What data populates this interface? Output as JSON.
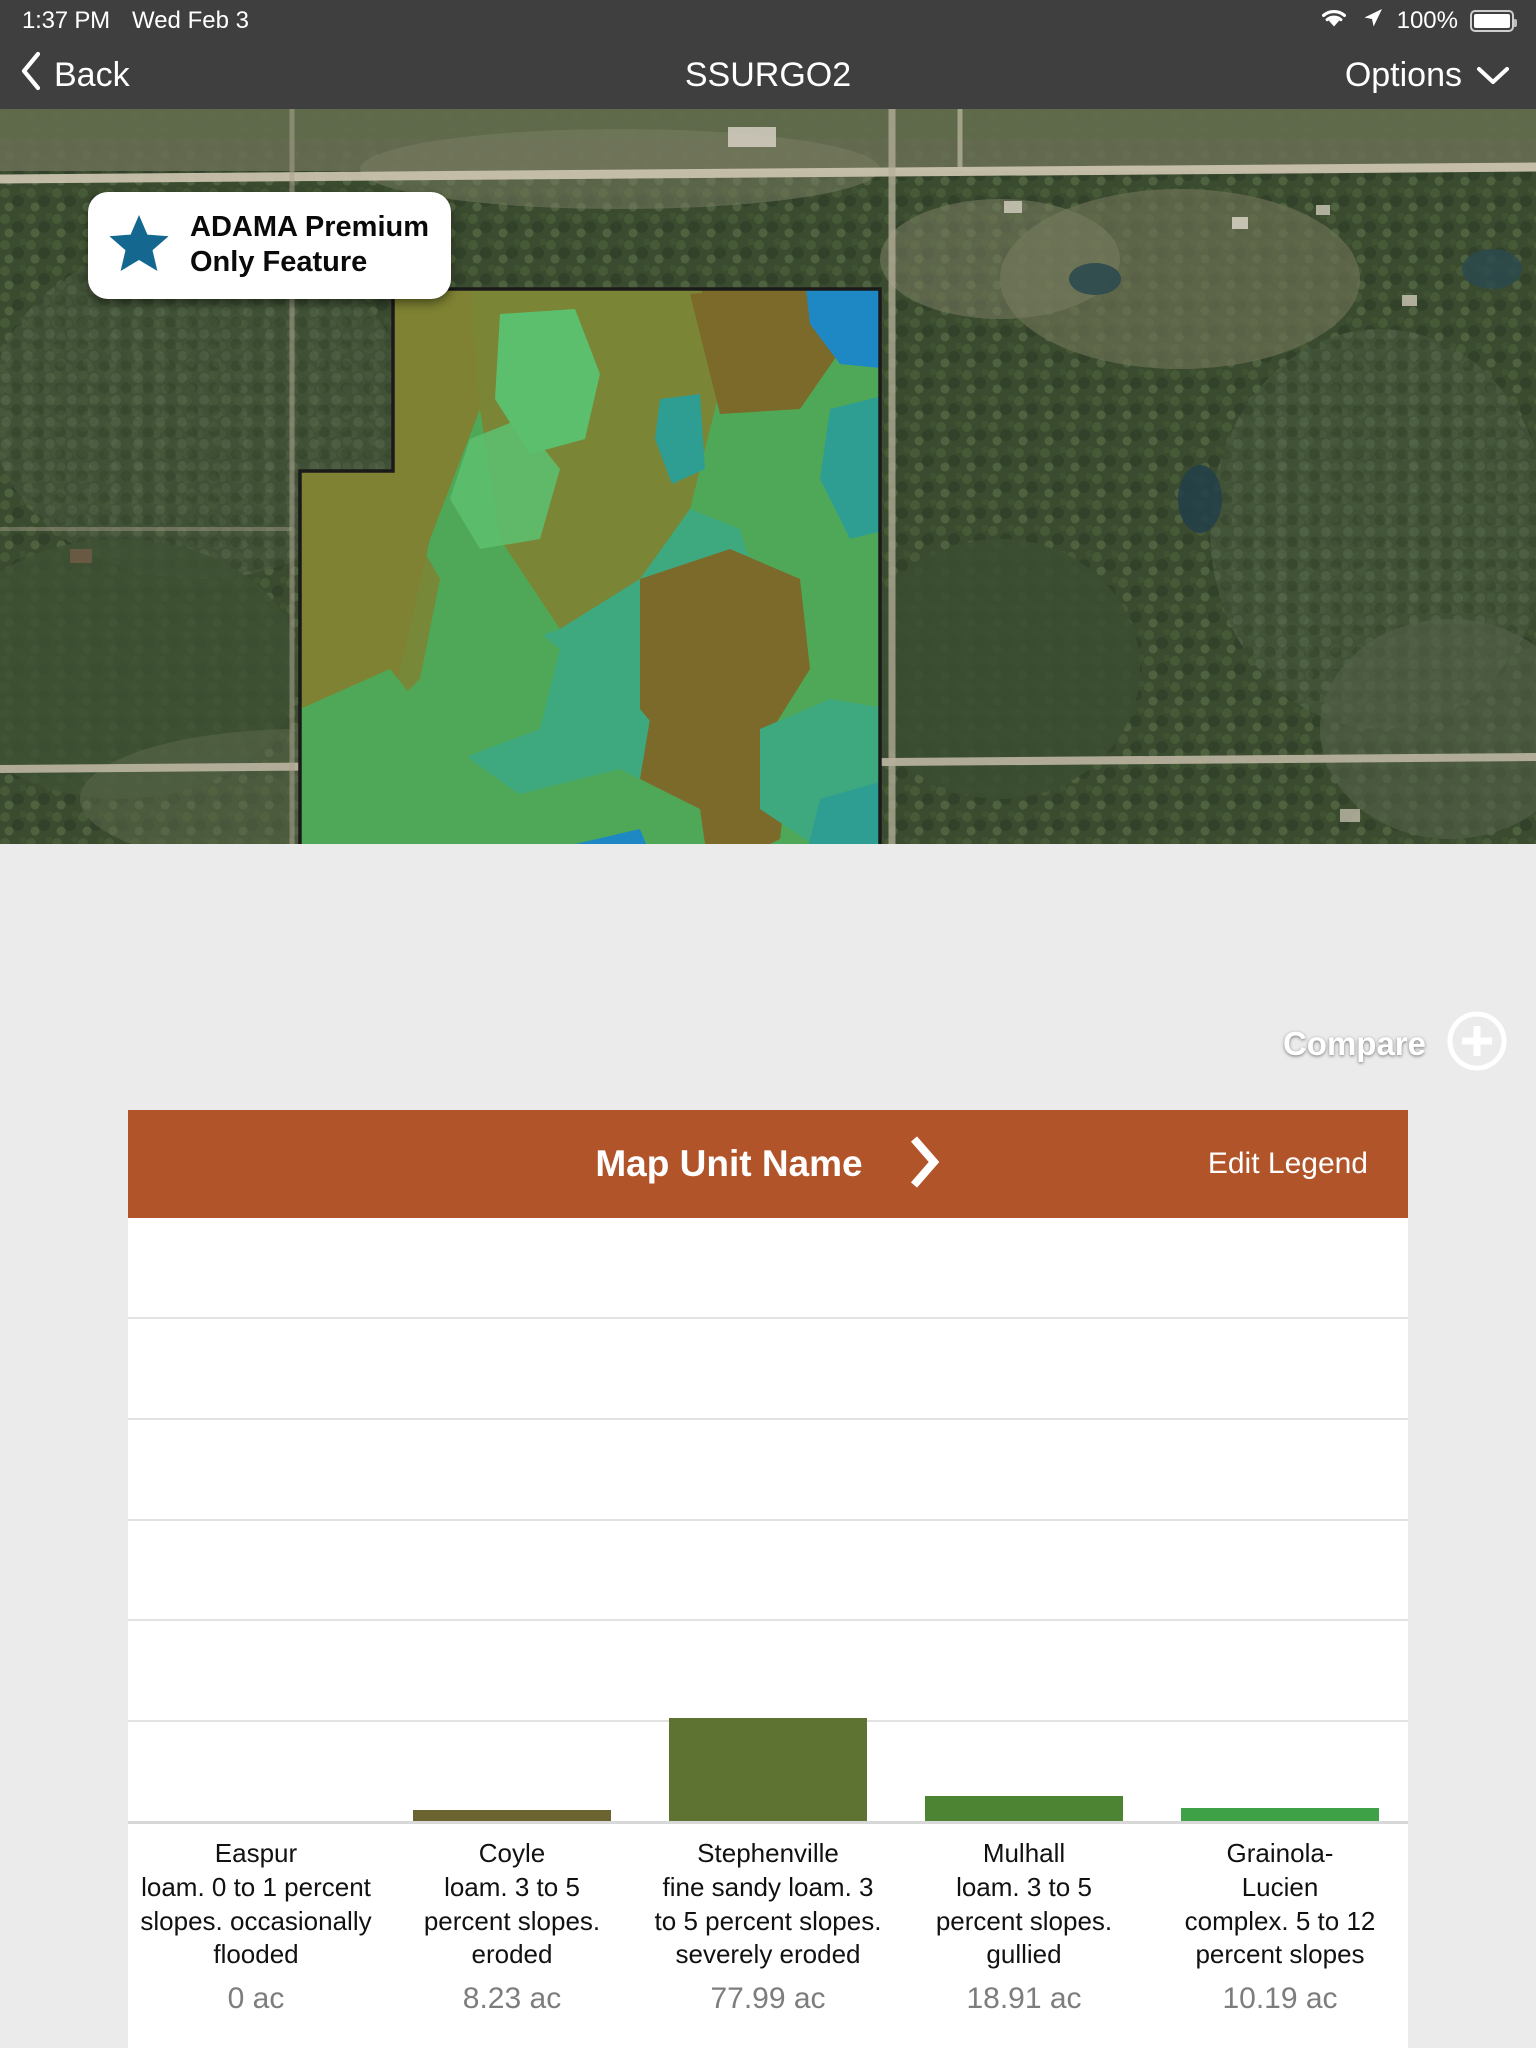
{
  "status_bar": {
    "time": "1:37 PM",
    "date": "Wed Feb 3",
    "wifi_icon": "wifi-icon",
    "location_icon": "location-arrow-icon",
    "battery_percent": "100%",
    "battery_icon": "battery-full-icon"
  },
  "nav_bar": {
    "back_label": "Back",
    "back_icon": "chevron-left-icon",
    "title": "SSURGO2",
    "options_label": "Options",
    "options_icon": "chevron-down-icon"
  },
  "map": {
    "premium_badge": {
      "icon": "star-icon",
      "text": "ADAMA Premium\nOnly Feature",
      "star_color": "#14688F"
    },
    "compare": {
      "label": "Compare",
      "icon": "plus-circle-icon"
    },
    "soil_colors": [
      "#7E8232",
      "#4FA857",
      "#5CBF6E",
      "#3EA87E",
      "#2E9E92",
      "#1E88C4",
      "#7C6A2A",
      "#6EB84F"
    ]
  },
  "legend_panel": {
    "header": {
      "title": "Map Unit Name",
      "chevron_icon": "chevron-right-icon",
      "edit_label": "Edit Legend",
      "accent_color": "#B2542A"
    }
  },
  "chart_data": {
    "type": "bar",
    "title": "Map Unit Name",
    "xlabel": "",
    "ylabel": "",
    "unit": "ac",
    "grid": true,
    "legend": "none",
    "ylim": [
      0,
      100
    ],
    "gridline_count": 6,
    "categories": [
      "Easpur\nloam. 0 to 1 percent\nslopes. occasionally\nflooded",
      "Coyle\nloam. 3 to 5\npercent slopes.\neroded",
      "Stephenville\nfine sandy loam. 3\nto 5 percent slopes.\nseverely eroded",
      "Mulhall\nloam. 3 to 5\npercent slopes.\ngullied",
      "Grainola-\nLucien\ncomplex. 5 to 12\npercent slopes"
    ],
    "values": [
      0,
      8.23,
      77.99,
      18.91,
      10.19
    ],
    "value_labels": [
      "0 ac",
      "8.23 ac",
      "77.99 ac",
      "18.91 ac",
      "10.19 ac"
    ],
    "bar_colors": [
      "#8C8C4A",
      "#6B6330",
      "#5E7331",
      "#4C8434",
      "#3EA047"
    ]
  }
}
